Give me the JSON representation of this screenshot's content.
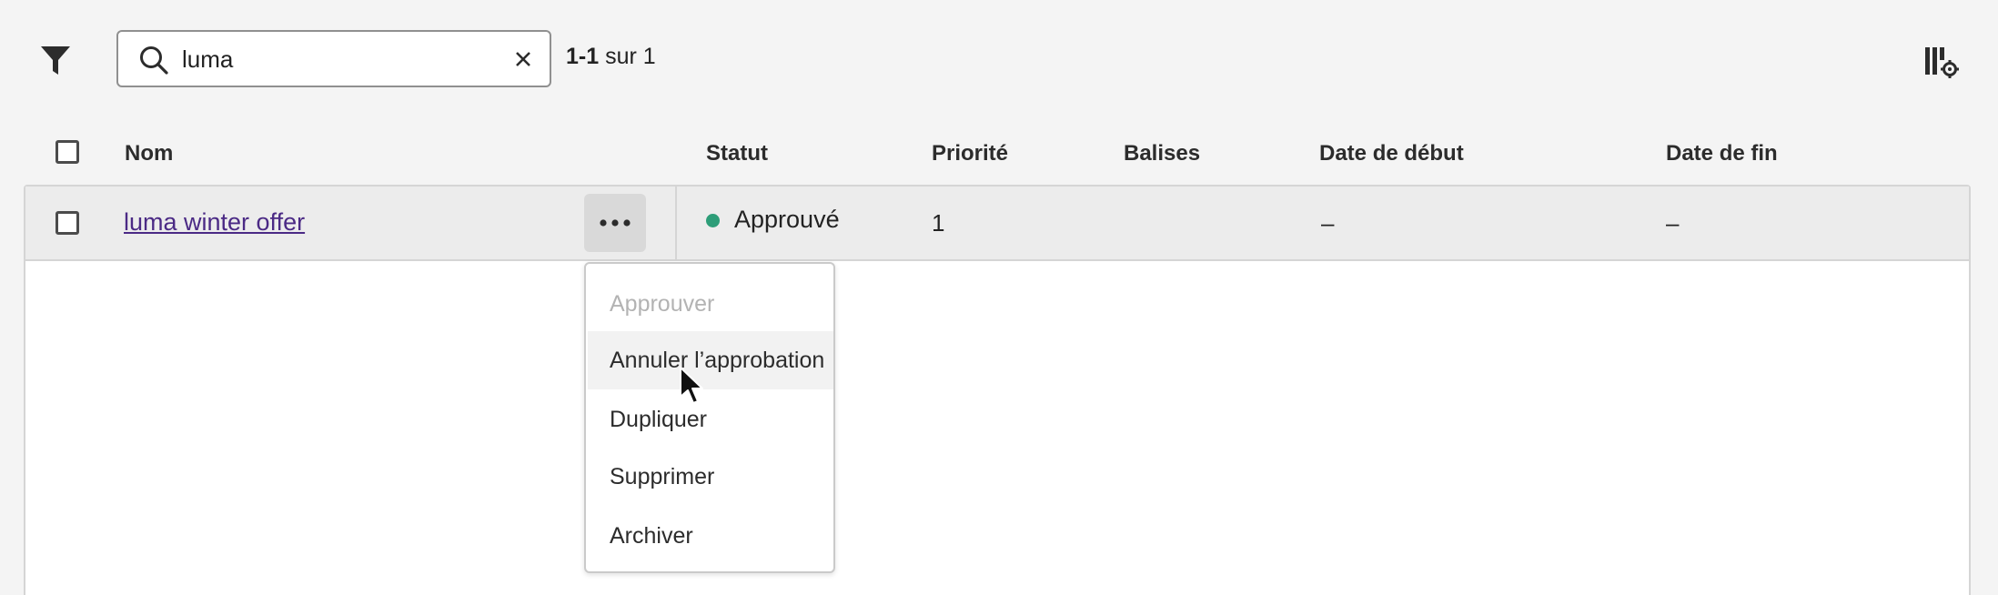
{
  "toolbar": {
    "search_value": "luma",
    "result_count_bold": "1-1",
    "result_count_rest": " sur 1",
    "icons": {
      "filter": "filter-icon",
      "search": "search-icon",
      "clear": "close-icon",
      "settings": "column-settings-icon"
    }
  },
  "table": {
    "headers": {
      "name": "Nom",
      "status": "Statut",
      "priority": "Priorité",
      "tags": "Balises",
      "start_date": "Date de début",
      "end_date": "Date de fin"
    },
    "rows": [
      {
        "name": "luma winter offer",
        "status": "Approuvé",
        "status_color": "#2d9d78",
        "priority": "1",
        "tags": "",
        "start_date": "–",
        "end_date": "–"
      }
    ]
  },
  "menu": {
    "items": [
      {
        "label": "Approuver",
        "disabled": true
      },
      {
        "label": "Annuler l’approbation",
        "hovered": true
      },
      {
        "label": "Dupliquer"
      },
      {
        "label": "Supprimer"
      },
      {
        "label": "Archiver"
      }
    ]
  },
  "colors": {
    "link": "#4b2a85",
    "status_approved": "#2d9d78",
    "row_selected_bg": "#ececec"
  }
}
